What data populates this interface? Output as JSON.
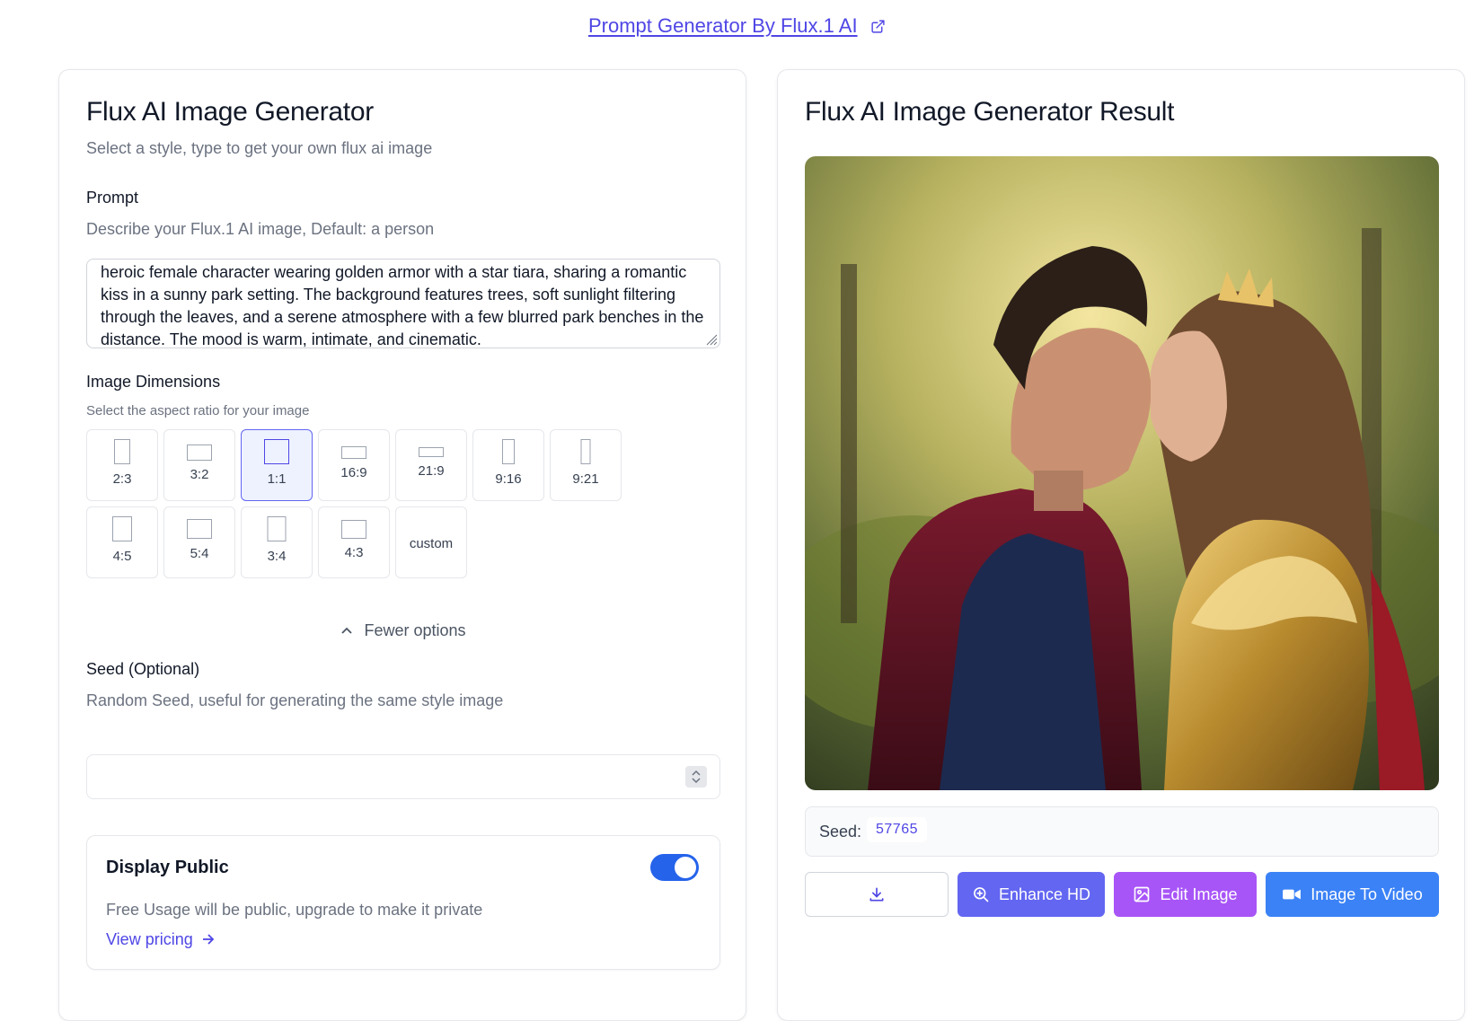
{
  "top_link": {
    "label": "Prompt Generator By Flux.1 AI",
    "icon": "external-link-icon"
  },
  "left": {
    "title": "Flux AI Image Generator",
    "subtitle": "Select a style, type to get your own flux ai image",
    "prompt": {
      "label": "Prompt",
      "hint": "Describe your Flux.1 AI image, Default: a person",
      "value": "heroic female character wearing golden armor with a star tiara, sharing a romantic kiss in a sunny park setting. The background features trees, soft sunlight filtering through the leaves, and a serene atmosphere with a few blurred park benches in the distance. The mood is warm, intimate, and cinematic."
    },
    "dimensions": {
      "label": "Image Dimensions",
      "hint": "Select the aspect ratio for your image",
      "selected": "1:1",
      "ratios": [
        "2:3",
        "3:2",
        "1:1",
        "16:9",
        "21:9",
        "9:16",
        "9:21",
        "4:5",
        "5:4",
        "3:4",
        "4:3",
        "custom"
      ],
      "fewer_label": "Fewer options"
    },
    "seed": {
      "label": "Seed (Optional)",
      "hint": "Random Seed, useful for generating the same style image",
      "value": ""
    },
    "display_public": {
      "title": "Display Public",
      "enabled": true,
      "description": "Free Usage will be public, upgrade to make it private",
      "pricing_link": "View pricing"
    }
  },
  "right": {
    "title": "Flux AI Image Generator Result",
    "seed_label": "Seed:",
    "seed_value": "57765",
    "buttons": {
      "download_icon": "download-icon",
      "enhance": "Enhance HD",
      "edit": "Edit Image",
      "video": "Image To Video"
    }
  },
  "colors": {
    "accent": "#6366f1",
    "link": "#4f46e5",
    "edit": "#a855f7",
    "video": "#3b82f6",
    "toggle": "#2563eb"
  }
}
